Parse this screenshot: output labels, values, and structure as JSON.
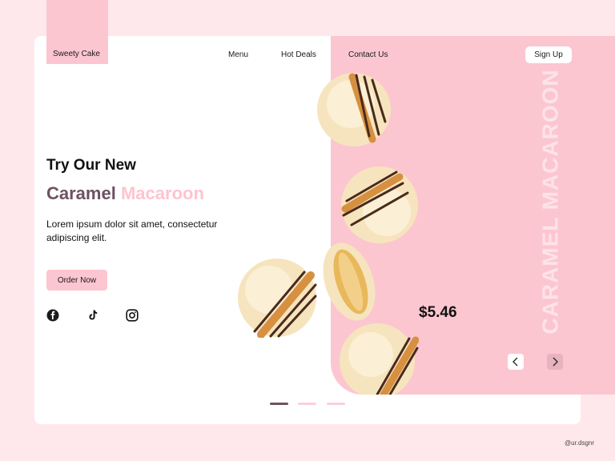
{
  "brand": {
    "name": "Sweety Cake"
  },
  "nav": {
    "items": [
      "Menu",
      "Hot Deals",
      "Contact Us"
    ],
    "signup": "Sign Up"
  },
  "hero": {
    "kicker": "Try Our New",
    "title_dark": "Caramel",
    "title_pink": "Macaroon",
    "description": "Lorem ipsum dolor sit amet, consectetur adipiscing elit.",
    "cta": "Order Now"
  },
  "social": {
    "icons": [
      "facebook-icon",
      "tiktok-icon",
      "instagram-icon"
    ]
  },
  "product": {
    "price": "$5.46",
    "vertical_text": "CARAMEL MACAROON"
  },
  "carousel": {
    "active_index": 0,
    "count": 3
  },
  "footer": {
    "credit": "@ur.dsgnr"
  },
  "colors": {
    "background": "#ffe8ec",
    "accent_pink": "#fcc6d0",
    "title_dark": "#6d5260",
    "title_pink": "#ffc3cf"
  }
}
